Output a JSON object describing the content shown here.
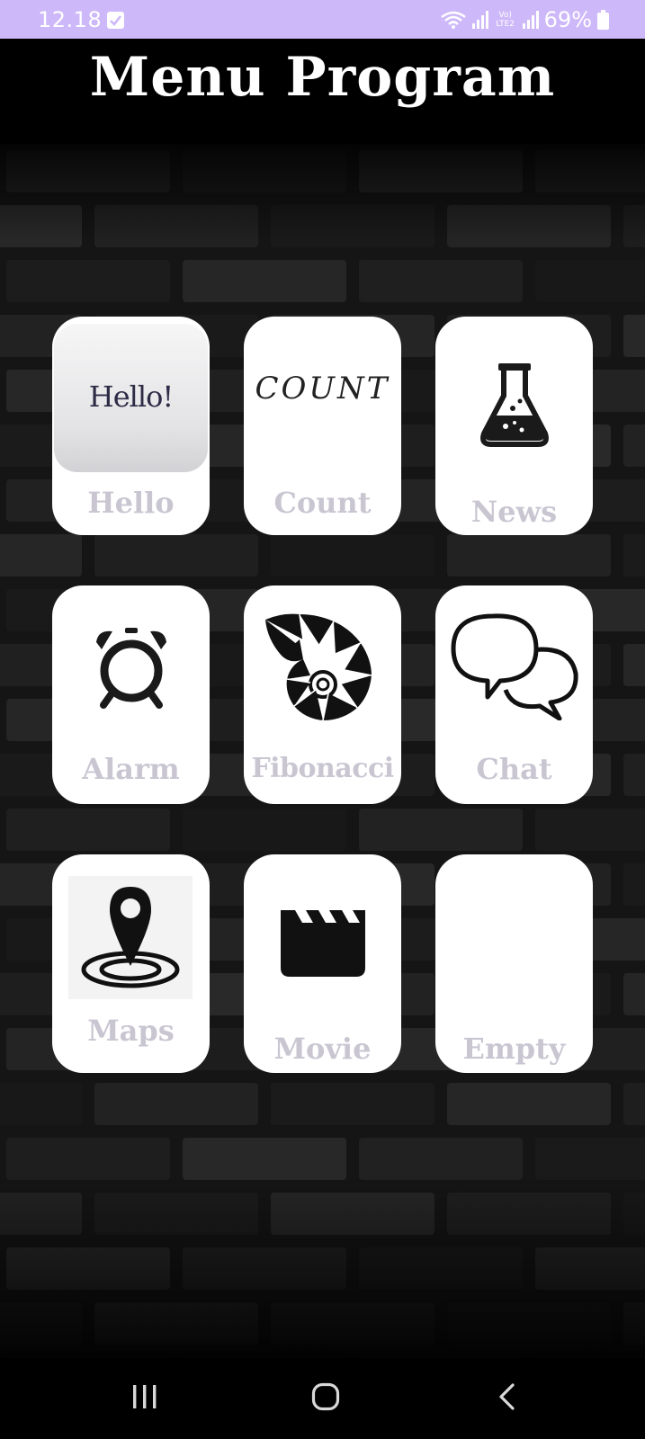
{
  "status_bar": {
    "time": "12.18",
    "battery": "69%",
    "network": "Vo) LTE2"
  },
  "header": {
    "title": "Menu Program"
  },
  "tiles": [
    {
      "label": "Hello",
      "icon": "hello-image",
      "image_text": "Hello!"
    },
    {
      "label": "Count",
      "icon": "count-image",
      "image_text": "COUNT"
    },
    {
      "label": "News",
      "icon": "flask-icon"
    },
    {
      "label": "Alarm",
      "icon": "alarm-clock-icon"
    },
    {
      "label": "Fibonacci",
      "icon": "nautilus-shell-icon"
    },
    {
      "label": "Chat",
      "icon": "chat-bubbles-icon"
    },
    {
      "label": "Maps",
      "icon": "map-pin-icon"
    },
    {
      "label": "Movie",
      "icon": "clapperboard-icon"
    },
    {
      "label": "Empty",
      "icon": ""
    }
  ],
  "nav": {
    "recent": "recent-apps-icon",
    "home": "home-icon",
    "back": "back-icon"
  },
  "colors": {
    "status_bar": "#cdb8f9",
    "tile_bg": "#ffffff",
    "tile_label": "#c9c6d2",
    "background": "#000000"
  }
}
